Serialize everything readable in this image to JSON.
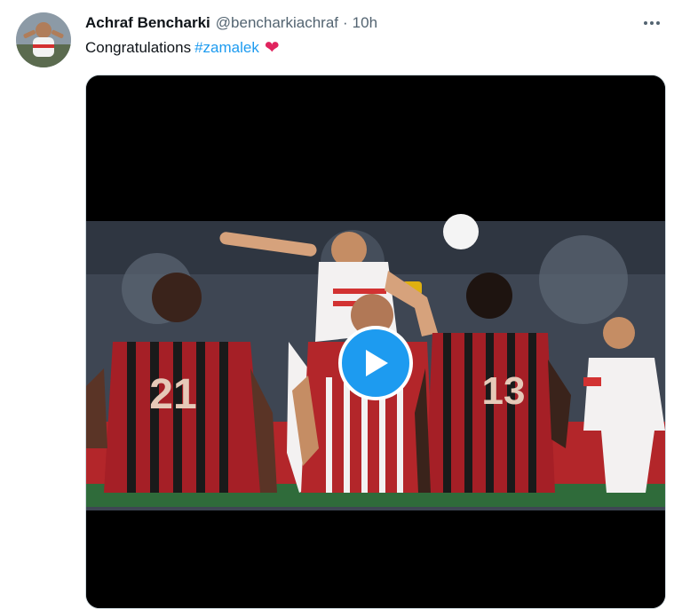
{
  "tweet": {
    "author_name": "Achraf Bencharki",
    "author_handle": "@bencharkiachraf",
    "separator": "·",
    "time": "10h",
    "text": "Congratulations",
    "hashtag": "#zamalek",
    "emoji": "❤"
  },
  "icons": {
    "more": "more-icon",
    "play": "play-icon",
    "heart": "heart-icon"
  },
  "colors": {
    "link": "#1d9bf0",
    "heart": "#e0245e",
    "secondary_text": "#536471"
  }
}
